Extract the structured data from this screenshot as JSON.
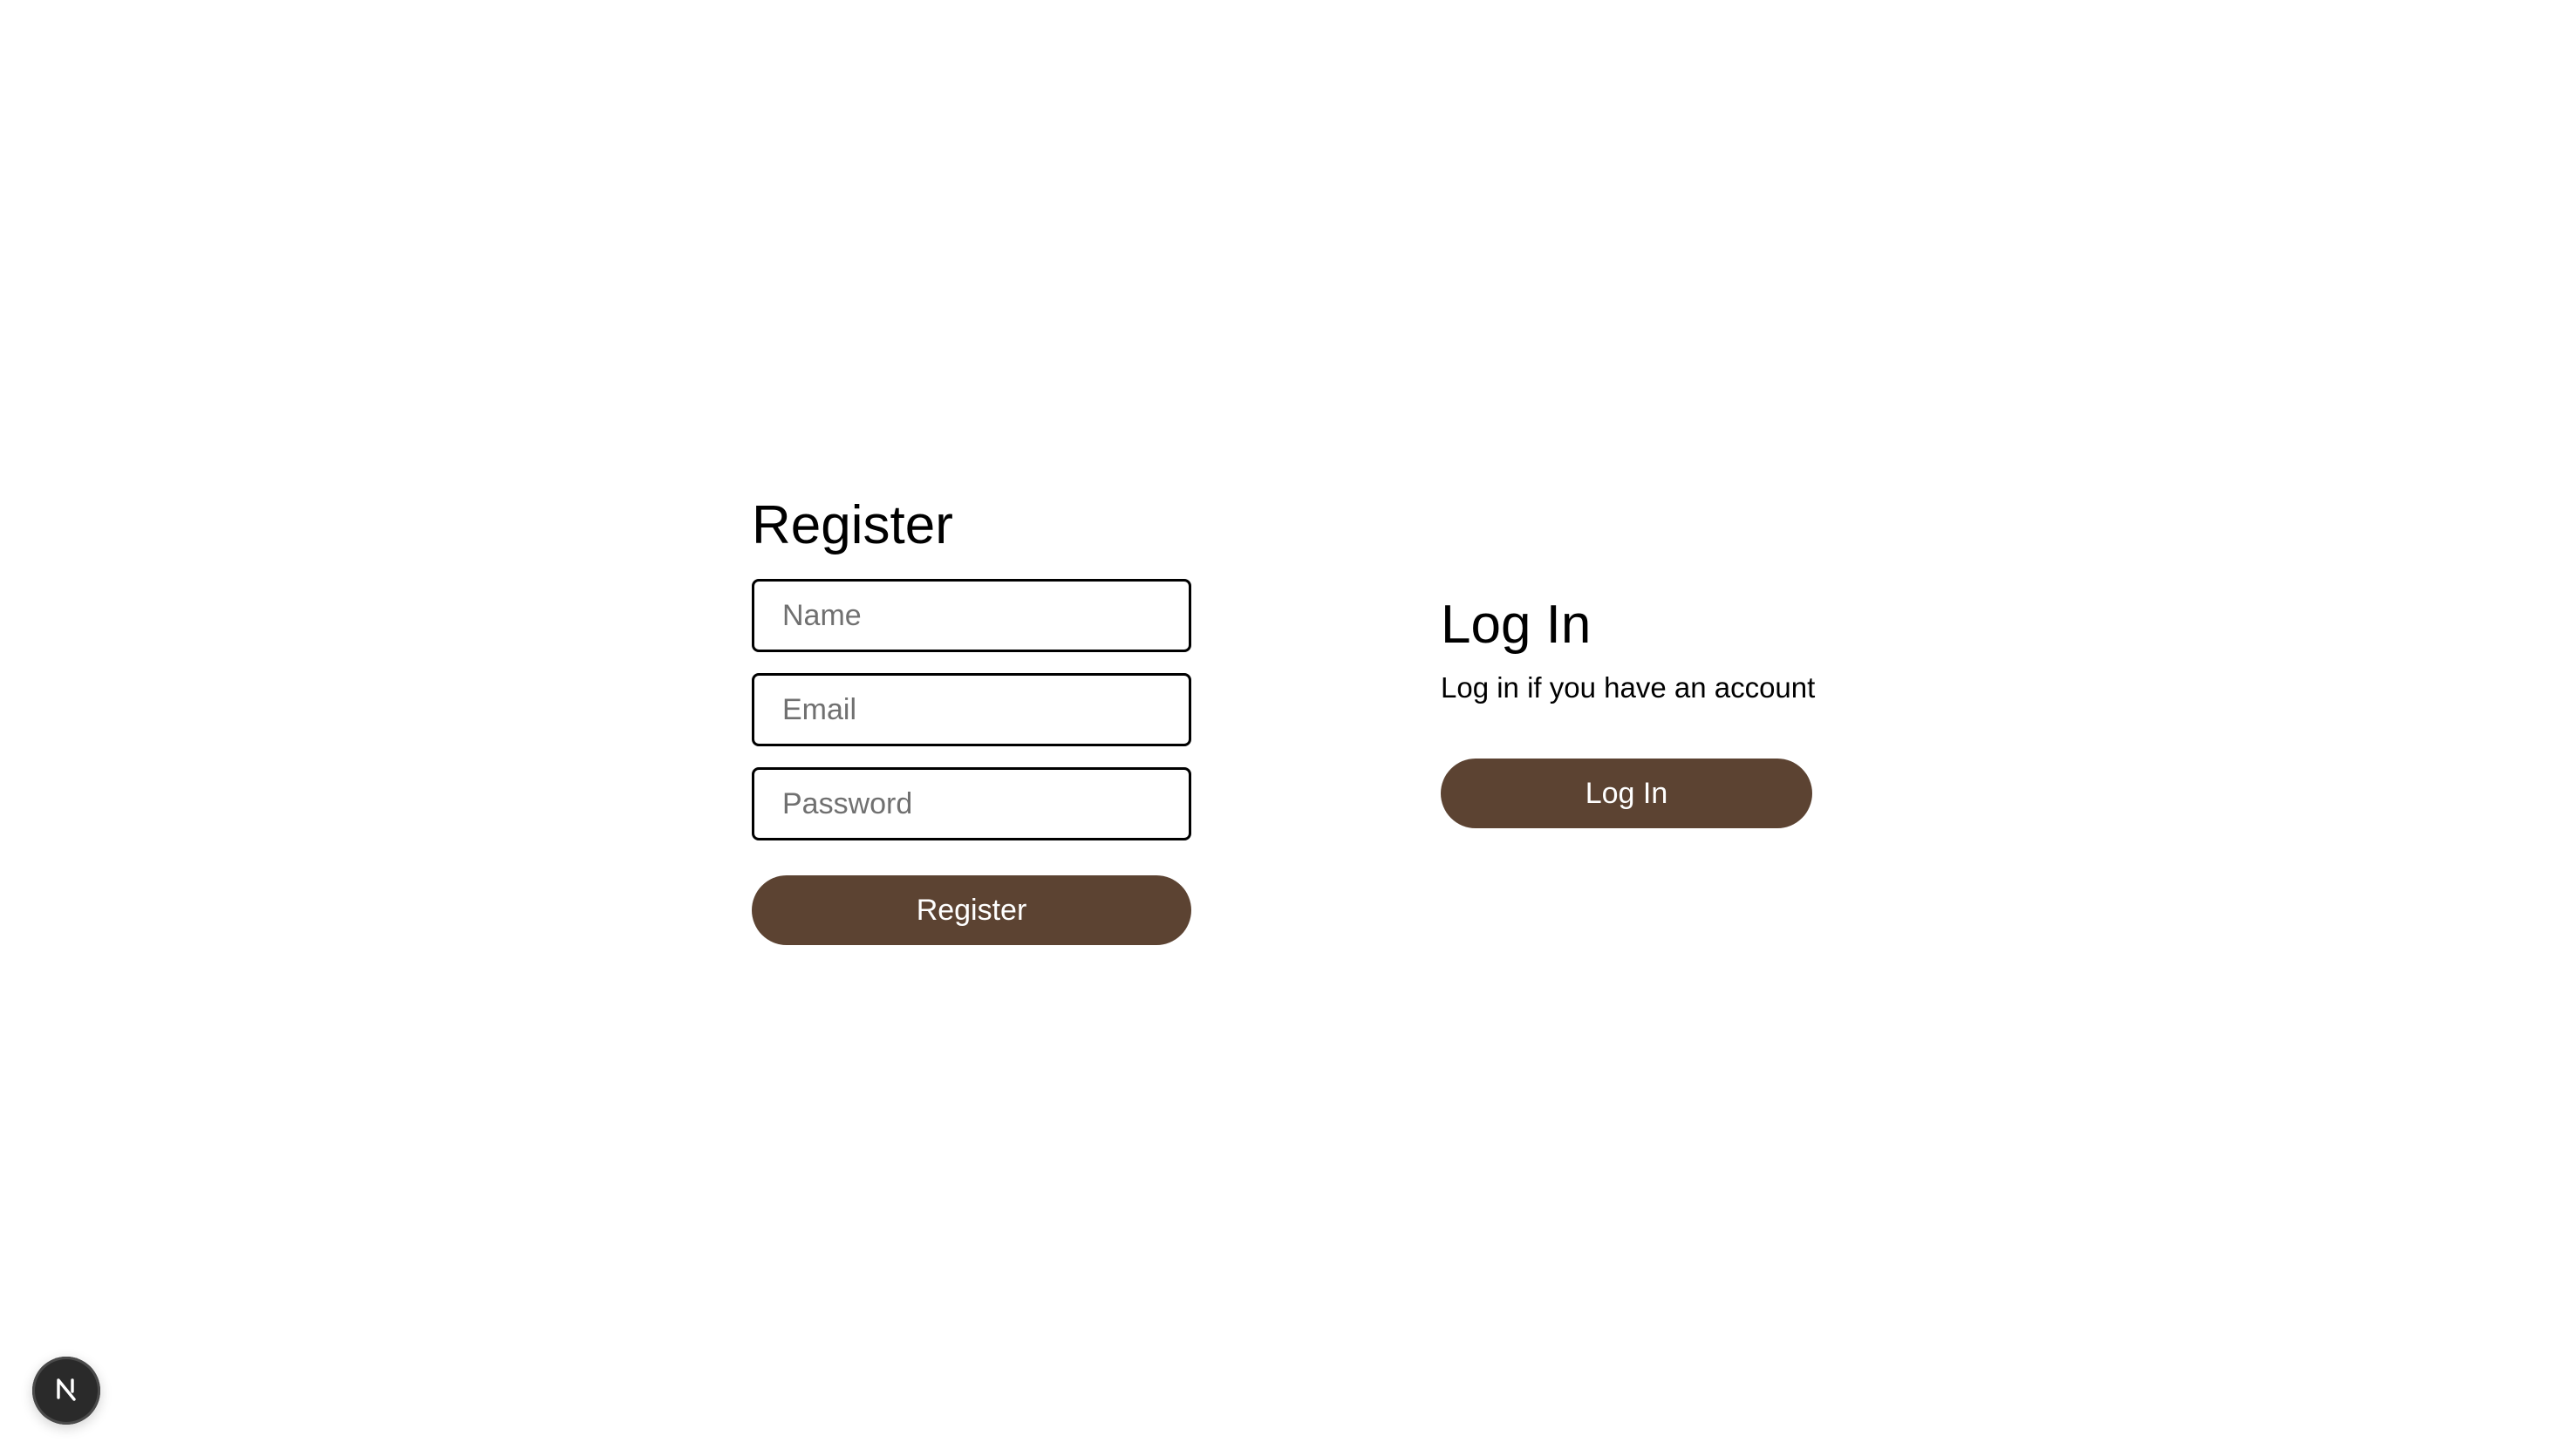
{
  "register": {
    "title": "Register",
    "fields": {
      "name_placeholder": "Name",
      "email_placeholder": "Email",
      "password_placeholder": "Password"
    },
    "submit_label": "Register"
  },
  "login": {
    "title": "Log In",
    "subtitle": "Log in if you have an account",
    "button_label": "Log In"
  },
  "colors": {
    "button_bg": "#5c4332",
    "button_text": "#ffffff",
    "badge_bg": "#2a2a2a"
  },
  "dev_indicator": {
    "icon": "nextjs-logo-icon"
  }
}
